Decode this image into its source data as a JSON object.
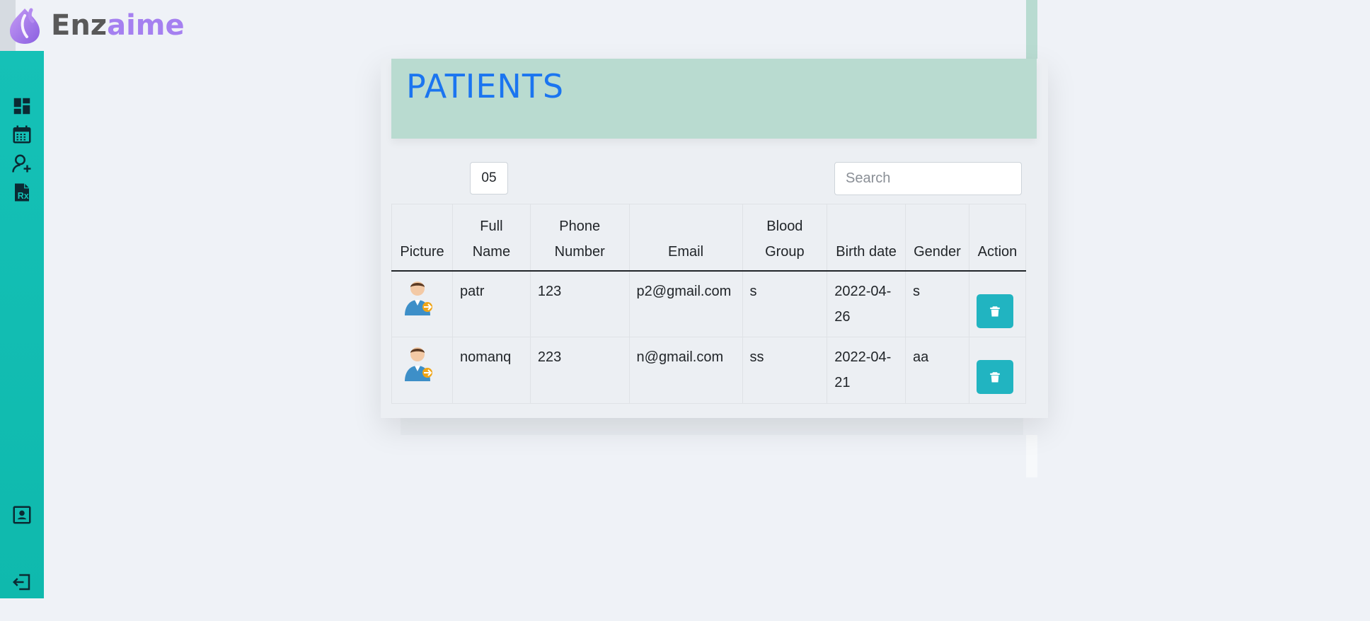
{
  "brand": {
    "name_part1": "Enz",
    "name_part2": "aime"
  },
  "sidebar": {
    "items": [
      {
        "icon": "dashboard-icon"
      },
      {
        "icon": "calendar-icon"
      },
      {
        "icon": "user-add-icon"
      },
      {
        "icon": "prescription-icon"
      }
    ],
    "bottom": [
      {
        "icon": "contact-card-icon"
      },
      {
        "icon": "logout-icon"
      }
    ]
  },
  "colors": {
    "sidebar": "#15c1b7",
    "header_bg": "#b9dbd0",
    "title": "#1b75f0",
    "action_button": "#21b4c1",
    "brand_accent": "#a580f0"
  },
  "page": {
    "title": "PATIENTS"
  },
  "controls": {
    "entries_value": "05",
    "search_placeholder": "Search"
  },
  "table": {
    "headers": {
      "picture": "Picture",
      "full_name": "Full Name",
      "phone": "Phone Number",
      "email": "Email",
      "blood": "Blood Group",
      "birth": "Birth date",
      "gender": "Gender",
      "action": "Action"
    },
    "rows": [
      {
        "name": "patr",
        "phone": "123",
        "email": "p2@gmail.com",
        "blood": "s",
        "birth": "2022-04-26",
        "gender": "s"
      },
      {
        "name": "nomanq",
        "phone": "223",
        "email": "n@gmail.com",
        "blood": "ss",
        "birth": "2022-04-21",
        "gender": "aa"
      }
    ]
  }
}
